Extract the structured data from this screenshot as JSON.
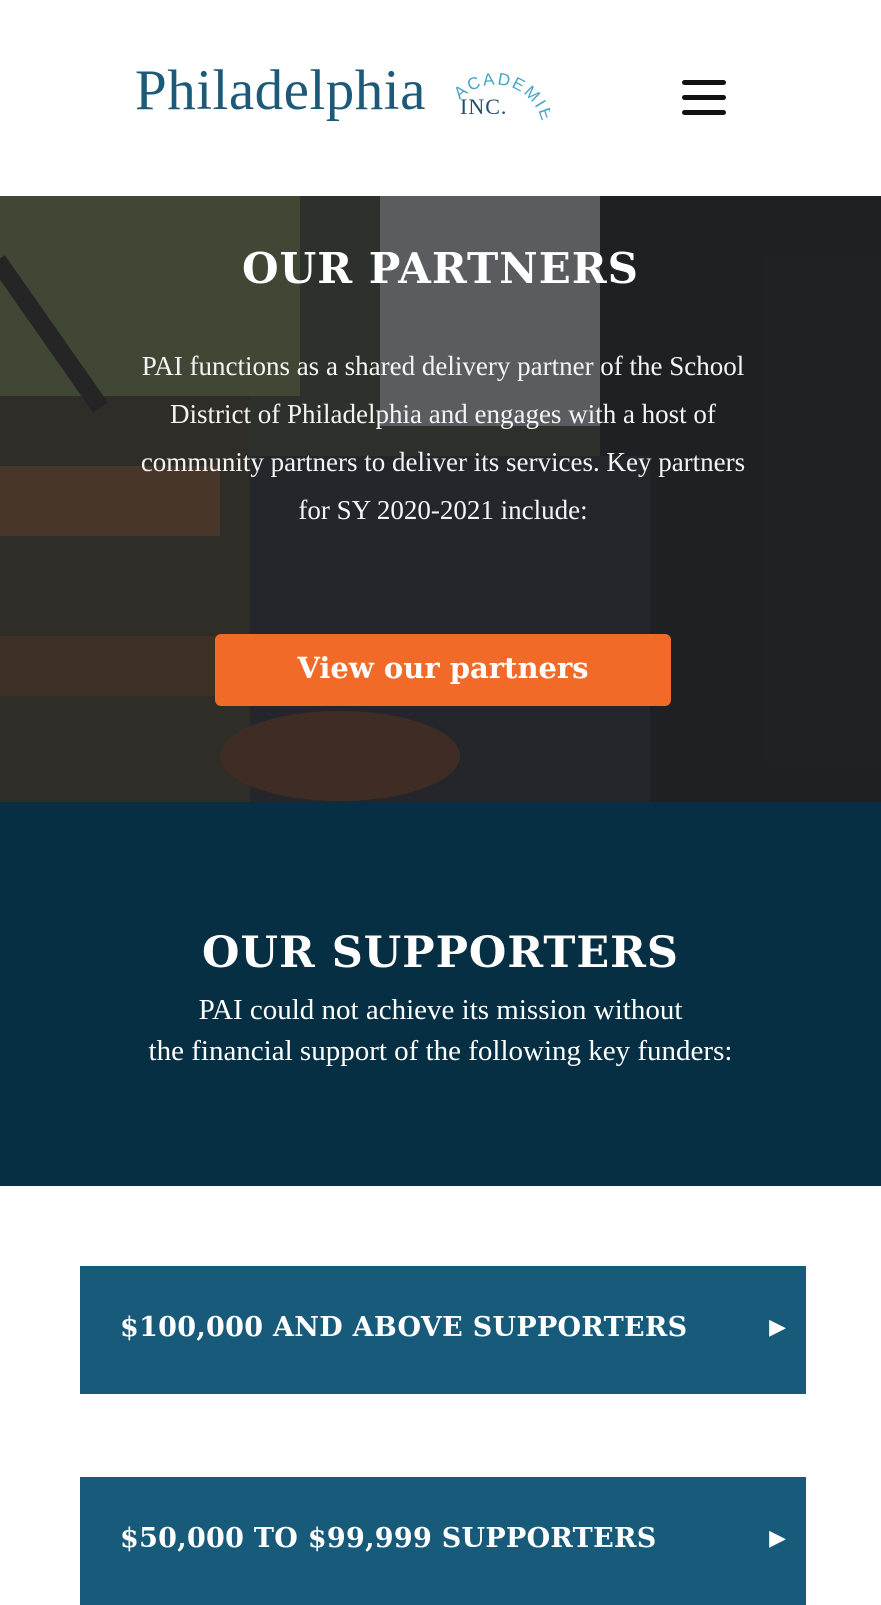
{
  "header": {
    "logo": {
      "name": "Philadelphia",
      "arc": "ACADEMIES",
      "inc": "INC."
    },
    "menu_icon": "hamburger-menu-icon"
  },
  "partners": {
    "title": "OUR PARTNERS",
    "text": "PAI functions as a shared delivery partner of the School District of Philadelphia and engages with a host of community partners to deliver its services. Key partners for SY 2020-2021 include:",
    "button_label": "View our partners"
  },
  "supporters": {
    "title": "OUR SUPPORTERS",
    "line1": "PAI could not achieve its mission without",
    "line2": "the financial support of the following key funders:"
  },
  "accordions": [
    {
      "label": "$100,000 AND ABOVE SUPPORTERS",
      "icon": "arrow-right-icon"
    },
    {
      "label": "$50,000 TO $99,999 SUPPORTERS",
      "icon": "arrow-right-icon"
    }
  ],
  "colors": {
    "brand_blue": "#1d5a7a",
    "logo_accent": "#4aa3c8",
    "button_orange": "#f26a27",
    "supporters_bg": "#072f44",
    "accordion_bg": "#185a7a"
  }
}
